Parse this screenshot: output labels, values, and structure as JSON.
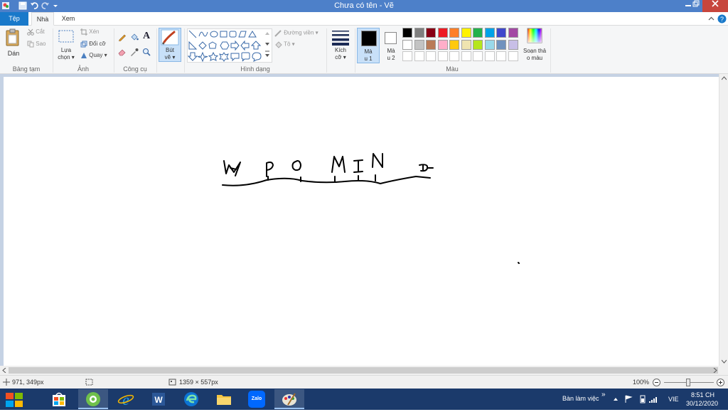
{
  "window": {
    "title": "Chưa có tên - Vẽ"
  },
  "tabs": [
    {
      "label": "Tệp"
    },
    {
      "label": "Nhà"
    },
    {
      "label": "Xem"
    }
  ],
  "ribbon": {
    "clipboard": {
      "paste_label": "Dán",
      "cut_label": "Cắt",
      "copy_label": "Sao",
      "group_label": "Bảng tạm"
    },
    "image": {
      "select_label_1": "Lựa",
      "select_label_2": "chọn ▾",
      "crop_label": "Xén",
      "resize_label": "Đổi cỡ",
      "rotate_label": "Quay ▾",
      "group_label": "Ảnh"
    },
    "tools": {
      "group_label": "Công cụ",
      "text_tool": "A"
    },
    "brushes": {
      "label_1": "Bút",
      "label_2": "vẽ ▾"
    },
    "shapes": {
      "outline_label": "Đường viền ▾",
      "fill_label": "Tô ▾",
      "group_label": "Hình dạng"
    },
    "size": {
      "label_1": "Kích",
      "label_2": "cỡ ▾"
    },
    "colors": {
      "color1_label_1": "Mà",
      "color1_label_2": "u 1",
      "color2_label_1": "Mà",
      "color2_label_2": "u 2",
      "edit_label_1": "Soạn thả",
      "edit_label_2": "o màu",
      "group_label": "Màu",
      "color1_value": "#000000",
      "color2_value": "#ffffff",
      "palette_row1": [
        "#000000",
        "#7f7f7f",
        "#880015",
        "#ed1c24",
        "#ff7f27",
        "#fff200",
        "#22b14c",
        "#00a2e8",
        "#3f48cc",
        "#a349a4"
      ],
      "palette_row2": [
        "#ffffff",
        "#c3c3c3",
        "#b97a57",
        "#ffaec9",
        "#ffc90e",
        "#efe4b0",
        "#b5e61d",
        "#99d9ea",
        "#7092be",
        "#c8bfe7"
      ],
      "palette_row3": [
        "#ffffff",
        "#ffffff",
        "#ffffff",
        "#ffffff",
        "#ffffff",
        "#ffffff",
        "#ffffff",
        "#ffffff",
        "#ffffff",
        "#ffffff"
      ]
    }
  },
  "status": {
    "cursor_pos": "971, 349px",
    "selection_size": "",
    "canvas_size": "1359 × 557px",
    "zoom": "100%"
  },
  "taskbar": {
    "desktop_label": "Bàn làm việc",
    "chevron": "»",
    "language": "VIE",
    "time": "8:51 CH",
    "date": "30/12/2020",
    "zalo_label": "Zalo"
  }
}
